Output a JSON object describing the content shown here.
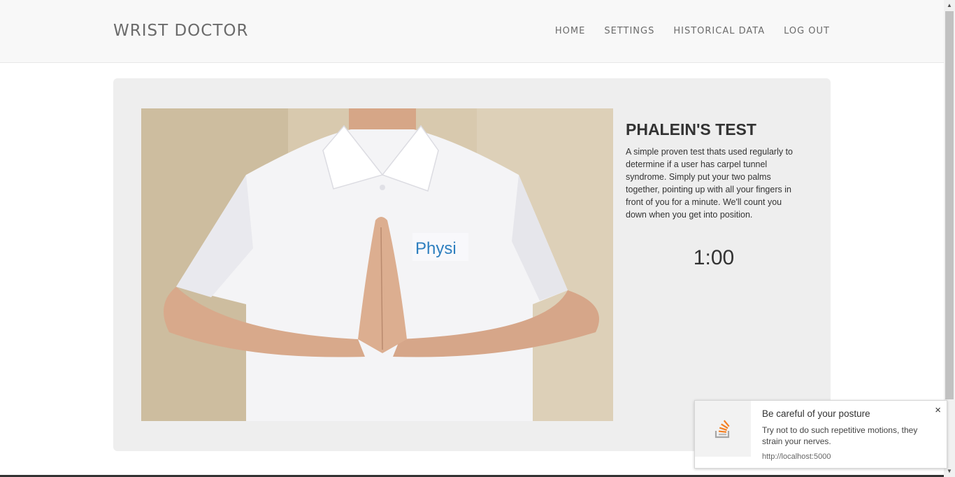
{
  "nav": {
    "brand": "WRIST DOCTOR",
    "links": [
      "HOME",
      "SETTINGS",
      "HISTORICAL DATA",
      "LOG OUT"
    ]
  },
  "test": {
    "title": "PHALEIN'S TEST",
    "description": "A simple proven test thats used regularly to determine if a user has carpel tunnel syndrome. Simply put your two palms together, pointing up with all your fingers in front of you for a minute. We'll count you down when you get into position.",
    "timer": "1:00",
    "image_alt": "Person holding palms together in front of chest",
    "shirt_logo": "Physi"
  },
  "notification": {
    "title": "Be careful of your posture",
    "body": "Try not to do such repetitive motions, they strain your nerves.",
    "url": "http://localhost:5000",
    "icon": "stack-overflow-icon",
    "close_label": "×"
  },
  "colors": {
    "navbar_bg": "#f8f8f8",
    "panel_bg": "#eeeeee",
    "nav_text": "#6b6b6b"
  }
}
